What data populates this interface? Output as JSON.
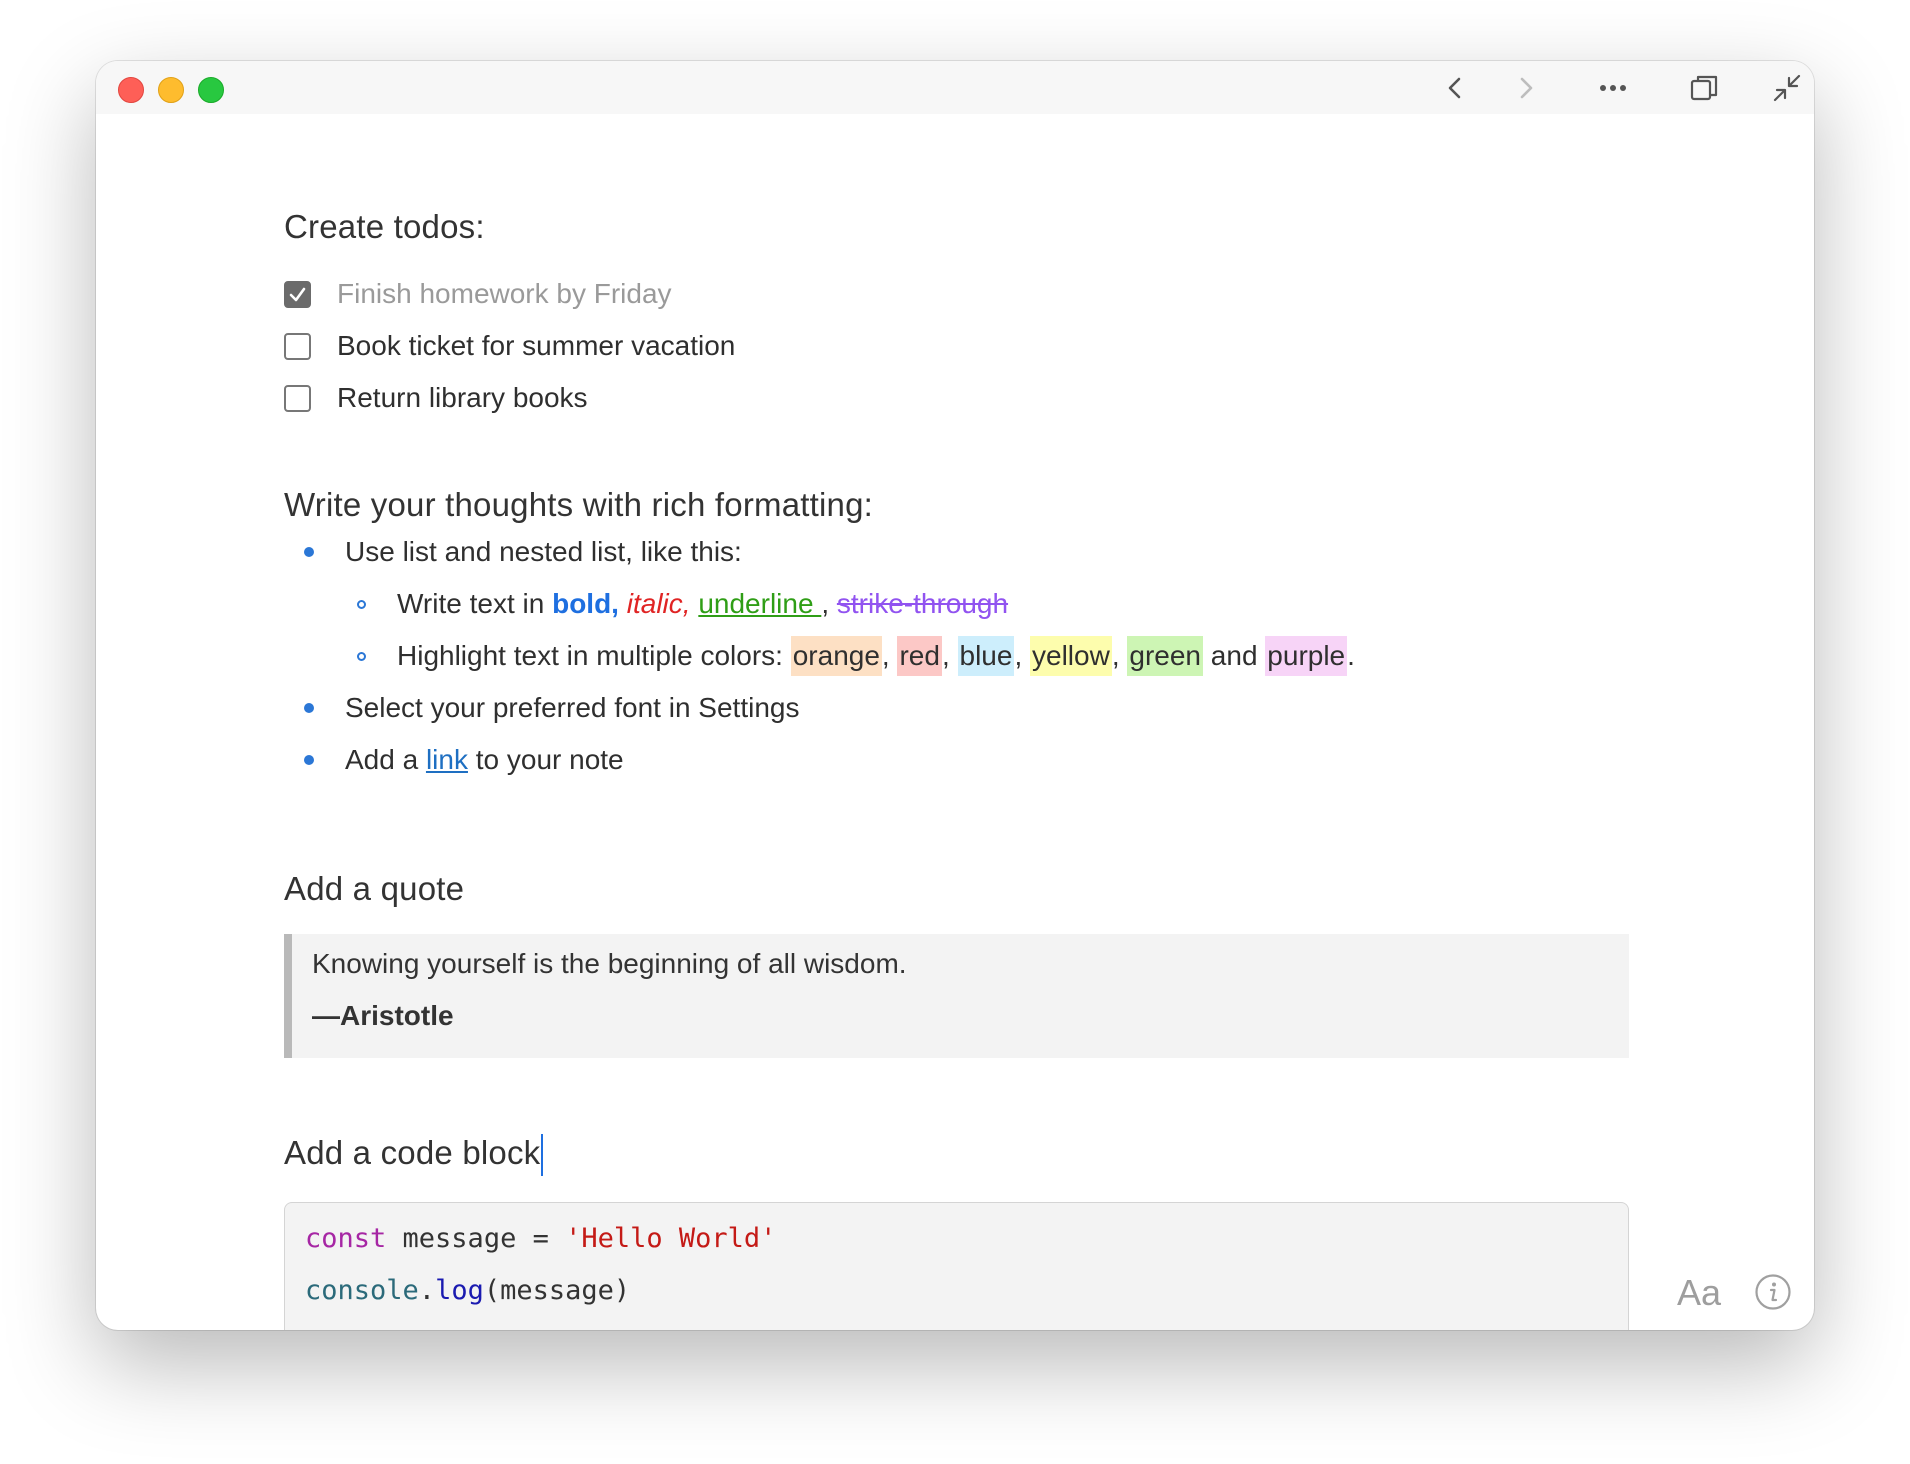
{
  "window": {
    "controls": [
      "close",
      "minimize",
      "maximize"
    ],
    "toolbar_icons": [
      "chevron-left-icon",
      "chevron-right-icon",
      "more-icon",
      "duplicate-icon",
      "minimize-window-icon"
    ]
  },
  "todos_section": {
    "heading": "Create todos:",
    "items": [
      {
        "label": "Finish homework by Friday",
        "checked": true
      },
      {
        "label": "Book ticket for summer vacation",
        "checked": false
      },
      {
        "label": "Return library books",
        "checked": false
      }
    ]
  },
  "rich_section": {
    "heading": "Write your thoughts with rich formatting:",
    "bullet1": "Use list and nested list, like this:",
    "nested1": {
      "prefix": "Write text in ",
      "bold": "bold,",
      "italic": "italic,",
      "underline": "underline ",
      "comma": ",",
      "strike": "strike-through"
    },
    "nested2": {
      "prefix": "Highlight text in multiple colors: ",
      "orange": "orange",
      "red": "red",
      "blue": "blue",
      "yellow": "yellow",
      "green": "green",
      "and": " and ",
      "purple": "purple",
      "sep": ", ",
      "period": "."
    },
    "bullet2": "Select your preferred font in Settings",
    "bullet3": {
      "prefix": "Add a ",
      "link": "link",
      "suffix": " to your note"
    }
  },
  "quote_section": {
    "heading": "Add a quote",
    "text": "Knowing yourself is the beginning of all wisdom.",
    "author": "—Aristotle"
  },
  "code_section": {
    "heading": "Add a code block",
    "line1": {
      "keyword": "const",
      "name": " message = ",
      "string": "'Hello World'"
    },
    "line2": {
      "object": "console",
      "dot": ".",
      "method": "log",
      "args": "(message)"
    }
  },
  "footer": {
    "font_label": "Aa",
    "info_icon": "info-icon"
  },
  "colors": {
    "accent": "#2b77d6",
    "bold": "#1e6fe0",
    "italic": "#e02424",
    "underline": "#2f9e16",
    "strike": "#9153f0"
  }
}
